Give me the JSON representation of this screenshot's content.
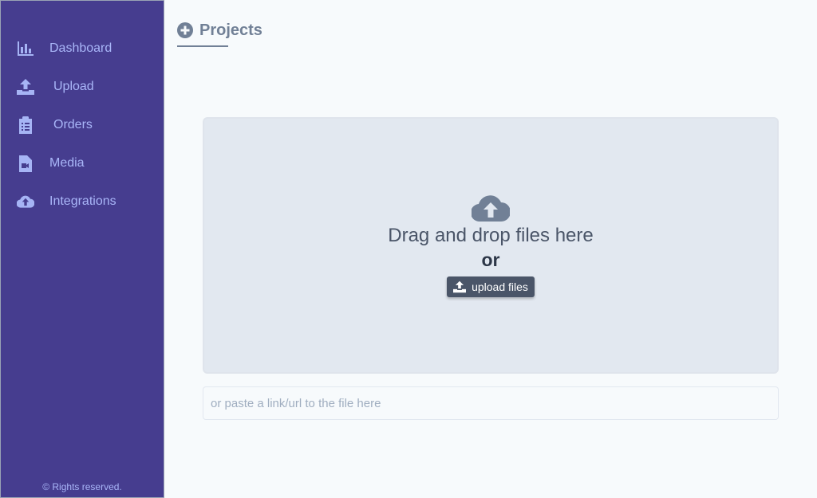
{
  "sidebar": {
    "items": [
      {
        "label": "Dashboard",
        "icon": "chart-bar-icon"
      },
      {
        "label": "Upload",
        "icon": "upload-icon"
      },
      {
        "label": "Orders",
        "icon": "clipboard-list-icon"
      },
      {
        "label": "Media",
        "icon": "file-video-icon"
      },
      {
        "label": "Integrations",
        "icon": "cloud-upload-icon"
      }
    ],
    "footer": "© Rights reserved."
  },
  "header": {
    "title": "Projects",
    "icon": "plus-circle-icon"
  },
  "dropzone": {
    "icon": "cloud-upload-icon",
    "text": "Drag and drop files here",
    "or": "or",
    "button_label": "upload files"
  },
  "url_input": {
    "placeholder": "or paste a link/url to the file here",
    "value": ""
  },
  "colors": {
    "sidebar_bg": "#463d8f",
    "sidebar_text": "#a9b6f8",
    "main_bg": "#f7fafc",
    "dropzone_bg": "#e2e8f0",
    "button_bg": "#4a5568"
  }
}
